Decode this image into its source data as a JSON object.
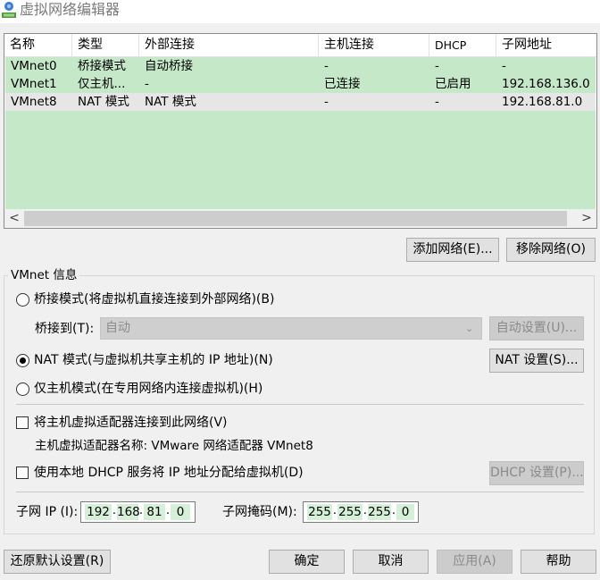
{
  "window": {
    "title": "虚拟网络编辑器",
    "icon": "network-editor-icon"
  },
  "table": {
    "columns": [
      "名称",
      "类型",
      "外部连接",
      "主机连接",
      "DHCP",
      "子网地址"
    ],
    "rows": [
      {
        "name": "VMnet0",
        "type": "桥接模式",
        "external": "自动桥接",
        "host": "-",
        "dhcp": "-",
        "subnet": "-"
      },
      {
        "name": "VMnet1",
        "type": "仅主机...",
        "external": "-",
        "host": "已连接",
        "dhcp": "已启用",
        "subnet": "192.168.136.0"
      },
      {
        "name": "VMnet8",
        "type": "NAT 模式",
        "external": "NAT 模式",
        "host": "-",
        "dhcp": "-",
        "subnet": "192.168.81.0"
      }
    ],
    "scroll_left": "<",
    "scroll_right": ">"
  },
  "buttons": {
    "add_network": "添加网络(E)...",
    "remove_network": "移除网络(O)",
    "auto_settings": "自动设置(U)...",
    "nat_settings": "NAT 设置(S)...",
    "dhcp_settings": "DHCP 设置(P)...",
    "restore_defaults": "还原默认设置(R)",
    "ok": "确定",
    "cancel": "取消",
    "apply": "应用(A)",
    "help": "帮助"
  },
  "vmnet_info": {
    "legend": "VMnet 信息",
    "bridged_label": "桥接模式(将虚拟机直接连接到外部网络)(B)",
    "bridge_to_label": "桥接到(T):",
    "bridge_to_value": "自动",
    "nat_label": "NAT 模式(与虚拟机共享主机的 IP 地址)(N)",
    "hostonly_label": "仅主机模式(在专用网络内连接虚拟机)(H)",
    "selected_mode": "nat",
    "connect_adapter_label": "将主机虚拟适配器连接到此网络(V)",
    "connect_adapter_checked": false,
    "adapter_name_text": "主机虚拟适配器名称: VMware 网络适配器 VMnet8",
    "use_dhcp_label": "使用本地 DHCP 服务将 IP 地址分配给虚拟机(D)",
    "use_dhcp_checked": false,
    "subnet_ip_label": "子网 IP (I):",
    "subnet_ip": [
      "192",
      "168",
      "81",
      "0"
    ],
    "subnet_mask_label": "子网掩码(M):",
    "subnet_mask": [
      "255",
      "255",
      "255",
      "0"
    ]
  },
  "colors": {
    "selected_row": "#c5e8c8",
    "current_row": "#e6e6e6",
    "octet_highlight": "#d6efd8"
  }
}
